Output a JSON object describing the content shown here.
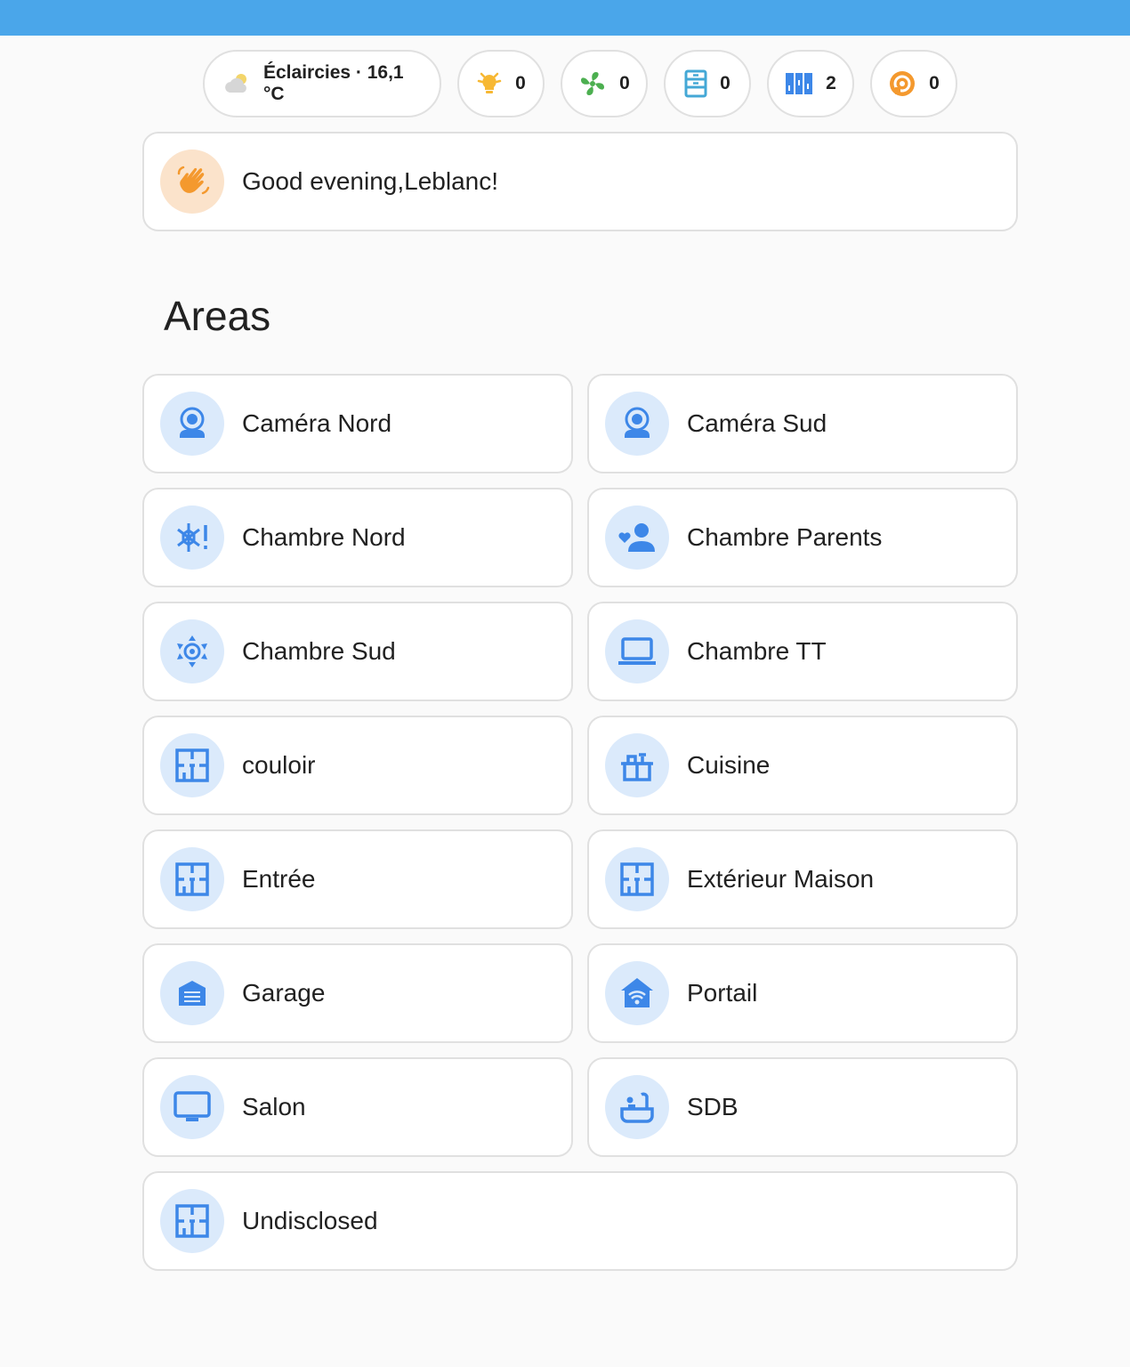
{
  "header": {
    "color": "#4aa6ea"
  },
  "status_chips": {
    "weather": {
      "icon": "partly-cloudy-icon",
      "label": "Éclaircies · 16,1 °C"
    },
    "lights": {
      "icon": "light-bulb-icon",
      "count": "0",
      "color": "#f7b833"
    },
    "fans": {
      "icon": "fan-icon",
      "count": "0",
      "color": "#4caf50"
    },
    "closets": {
      "icon": "closet-icon",
      "count": "0",
      "color": "#44a8d6"
    },
    "shutters": {
      "icon": "blinds-icon",
      "count": "2",
      "color": "#3d87e8"
    },
    "media": {
      "icon": "speaker-icon",
      "count": "0",
      "color": "#f4992e"
    }
  },
  "greeting": {
    "icon": "waving-hand-icon",
    "text": "Good evening,Leblanc!"
  },
  "areas": {
    "heading": "Areas",
    "items": [
      {
        "label": "Caméra Nord",
        "icon": "webcam-icon"
      },
      {
        "label": "Caméra Sud",
        "icon": "webcam-icon"
      },
      {
        "label": "Chambre Nord",
        "icon": "snowflake-alert-icon"
      },
      {
        "label": "Chambre Parents",
        "icon": "account-heart-icon"
      },
      {
        "label": "Chambre Sud",
        "icon": "sun-thermometer-icon"
      },
      {
        "label": "Chambre TT",
        "icon": "laptop-icon"
      },
      {
        "label": "couloir",
        "icon": "floor-plan-icon"
      },
      {
        "label": "Cuisine",
        "icon": "stove-icon"
      },
      {
        "label": "Entrée",
        "icon": "floor-plan-icon"
      },
      {
        "label": "Extérieur Maison",
        "icon": "floor-plan-icon"
      },
      {
        "label": "Garage",
        "icon": "garage-icon"
      },
      {
        "label": "Portail",
        "icon": "home-wifi-icon"
      },
      {
        "label": "Salon",
        "icon": "monitor-icon"
      },
      {
        "label": "SDB",
        "icon": "bathtub-icon"
      },
      {
        "label": "Undisclosed",
        "icon": "floor-plan-icon"
      }
    ]
  },
  "colors": {
    "area_icon": "#3d87e8",
    "area_icon_bg": "#dbeafb",
    "greeting_icon": "#f4992e"
  }
}
